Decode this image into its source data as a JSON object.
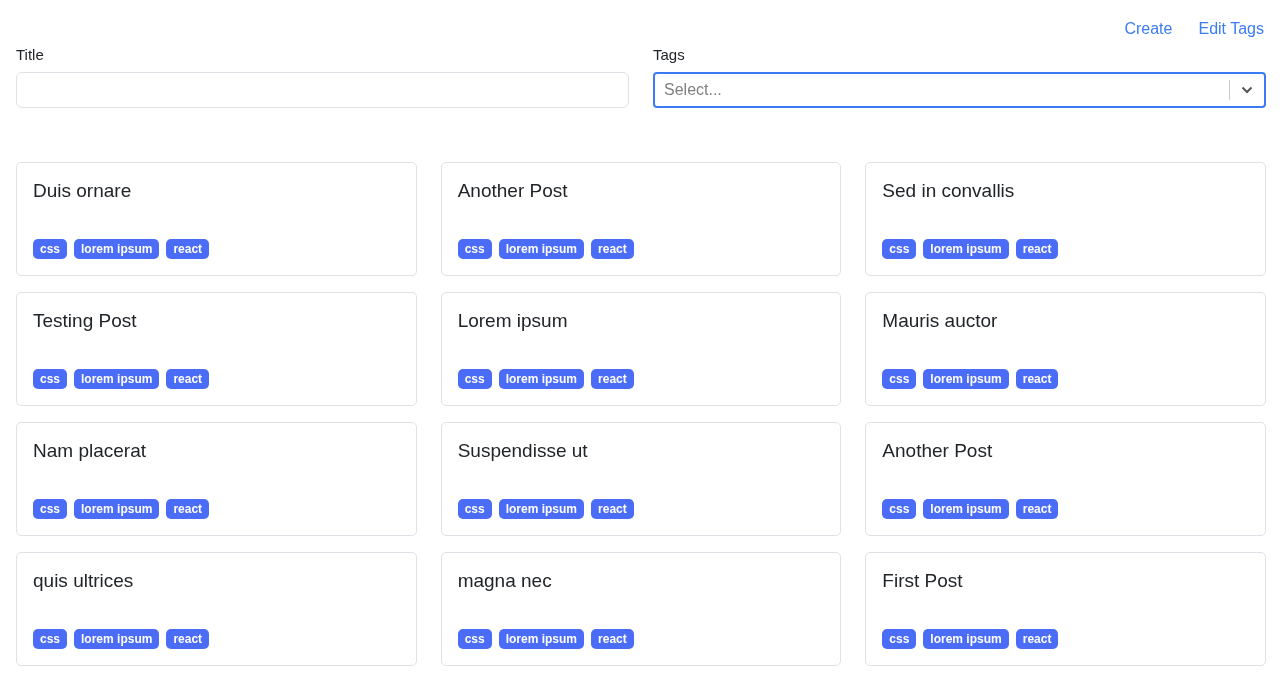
{
  "nav_links": [
    "Create",
    "Edit Tags"
  ],
  "title_field": {
    "label": "Title"
  },
  "tags_field": {
    "label": "Tags",
    "placeholder": "Select...",
    "focused": true
  },
  "posts": [
    {
      "title": "Duis ornare",
      "tags": [
        "css",
        "lorem ipsum",
        "react"
      ]
    },
    {
      "title": "Another Post",
      "tags": [
        "css",
        "lorem ipsum",
        "react"
      ]
    },
    {
      "title": "Sed in convallis",
      "tags": [
        "css",
        "lorem ipsum",
        "react"
      ]
    },
    {
      "title": "Testing Post",
      "tags": [
        "css",
        "lorem ipsum",
        "react"
      ]
    },
    {
      "title": "Lorem ipsum",
      "tags": [
        "css",
        "lorem ipsum",
        "react"
      ]
    },
    {
      "title": "Mauris auctor",
      "tags": [
        "css",
        "lorem ipsum",
        "react"
      ]
    },
    {
      "title": "Nam placerat",
      "tags": [
        "css",
        "lorem ipsum",
        "react"
      ]
    },
    {
      "title": "Suspendisse ut",
      "tags": [
        "css",
        "lorem ipsum",
        "react"
      ]
    },
    {
      "title": "Another Post",
      "tags": [
        "css",
        "lorem ipsum",
        "react"
      ]
    },
    {
      "title": "quis ultrices",
      "tags": [
        "css",
        "lorem ipsum",
        "react"
      ]
    },
    {
      "title": "magna nec",
      "tags": [
        "css",
        "lorem ipsum",
        "react"
      ]
    },
    {
      "title": "First Post",
      "tags": [
        "css",
        "lorem ipsum",
        "react"
      ]
    }
  ]
}
